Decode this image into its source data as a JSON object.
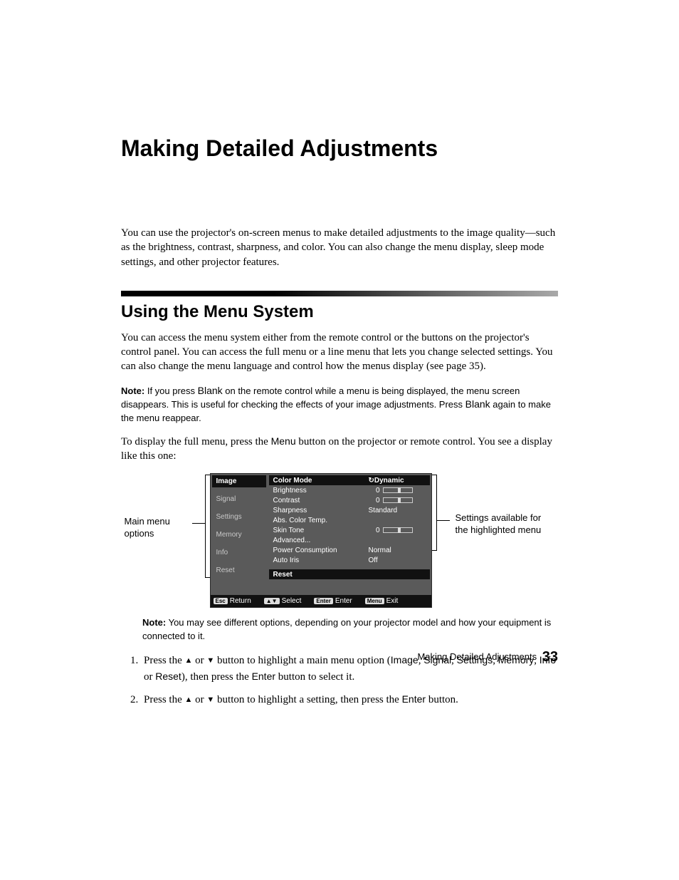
{
  "title": "Making Detailed Adjustments",
  "intro": "You can use the projector's on-screen menus to make detailed adjustments to the image quality—such as the brightness, contrast, sharpness, and color. You can also change the menu display, sleep mode settings, and other projector features.",
  "section1": {
    "heading": "Using the Menu System",
    "para1": "You can access the menu system either from the remote control or the buttons on the projector's control panel. You can access the full menu or a line menu that lets you change selected settings. You can also change the menu language and control how the menus display (see page 35).",
    "note1_label": "Note:",
    "note1_a": " If you press ",
    "note1_blank1": "Blank",
    "note1_b": " on the remote control while a menu is being displayed, the menu screen disappears. This is useful for checking the effects of your image adjustments. Press ",
    "note1_blank2": "Blank",
    "note1_c": " again to make the menu reappear.",
    "para2_a": "To display the full menu, press the ",
    "para2_menu": "Menu",
    "para2_b": " button on the projector or remote control. You see a display like this one:",
    "note2_label": "Note:",
    "note2_body": " You may see different options, depending on your projector model and how your equipment is connected to it."
  },
  "figure": {
    "left_label": "Main menu options",
    "right_label": "Settings available for the highlighted menu",
    "side_items": [
      "Image",
      "Signal",
      "Settings",
      "Memory",
      "Info",
      "Reset"
    ],
    "rows": [
      {
        "label": "Color Mode",
        "value": "Dynamic",
        "type": "head",
        "icon": "↻"
      },
      {
        "label": "Brightness",
        "value": "0",
        "type": "bar"
      },
      {
        "label": "Contrast",
        "value": "0",
        "type": "bar"
      },
      {
        "label": "Sharpness",
        "value": "Standard",
        "type": "text"
      },
      {
        "label": "Abs. Color Temp.",
        "value": "",
        "type": "text"
      },
      {
        "label": "Skin Tone",
        "value": "0",
        "type": "bar"
      },
      {
        "label": "Advanced...",
        "value": "",
        "type": "text"
      },
      {
        "label": "Power Consumption",
        "value": "Normal",
        "type": "text"
      },
      {
        "label": "Auto Iris",
        "value": "Off",
        "type": "text"
      }
    ],
    "reset_label": "Reset",
    "footer": [
      {
        "key": "Esc",
        "label": "Return"
      },
      {
        "key": "▲▼",
        "label": "Select"
      },
      {
        "key": "Enter",
        "label": "Enter"
      },
      {
        "key": "Menu",
        "label": "Exit"
      }
    ]
  },
  "steps": {
    "s1_a": "Press the ",
    "up": "▲",
    "or": " or ",
    "down": "▼",
    "s1_b": " button to highlight a main menu option (",
    "m1": "Image",
    "c": ", ",
    "m2": "Signal",
    "m3": "Settings",
    "m4": "Memory",
    "m5": "Info",
    "or2": " or ",
    "m6": "Reset",
    "s1_c": "), then press the ",
    "enter": "Enter",
    "s1_d": " button to select it.",
    "s2_a": "Press the ",
    "s2_b": " button to highlight a setting, then press the ",
    "s2_c": " button."
  },
  "footer": {
    "text": "Making Detailed Adjustments",
    "page": "33"
  }
}
